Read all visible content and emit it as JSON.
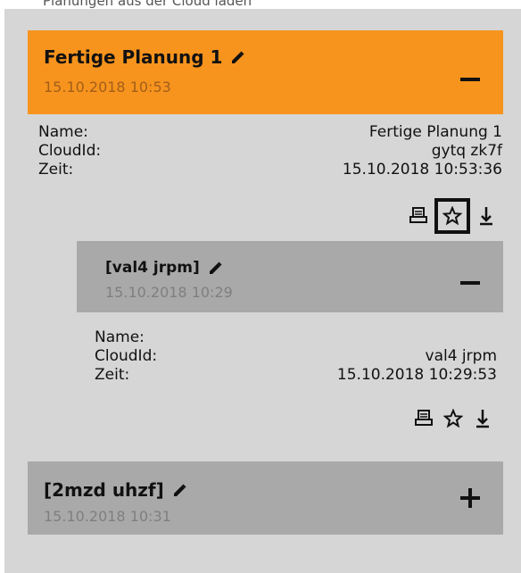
{
  "header_cut_text": "Planungen aus der Cloud laden",
  "accent_color": "#f7941e",
  "groups": [
    {
      "title": "Fertige Planung 1",
      "date": "15.10.2018 10:53",
      "toggle": "minus",
      "details": [
        {
          "label": "Name:",
          "value": "Fertige Planung 1"
        },
        {
          "label": "CloudId:",
          "value": "gytq zk7f"
        },
        {
          "label": "Zeit:",
          "value": "15.10.2018 10:53:36"
        }
      ],
      "focused_action": "star-icon",
      "subitems": [
        {
          "title": "[val4 jrpm]",
          "date": "15.10.2018 10:29",
          "toggle": "minus",
          "details": [
            {
              "label": "Name:",
              "value": ""
            },
            {
              "label": "CloudId:",
              "value": "val4 jrpm"
            },
            {
              "label": "Zeit:",
              "value": "15.10.2018 10:29:53"
            }
          ]
        }
      ]
    },
    {
      "title": "[2mzd uhzf]",
      "date": "15.10.2018 10:31",
      "toggle": "plus"
    }
  ]
}
